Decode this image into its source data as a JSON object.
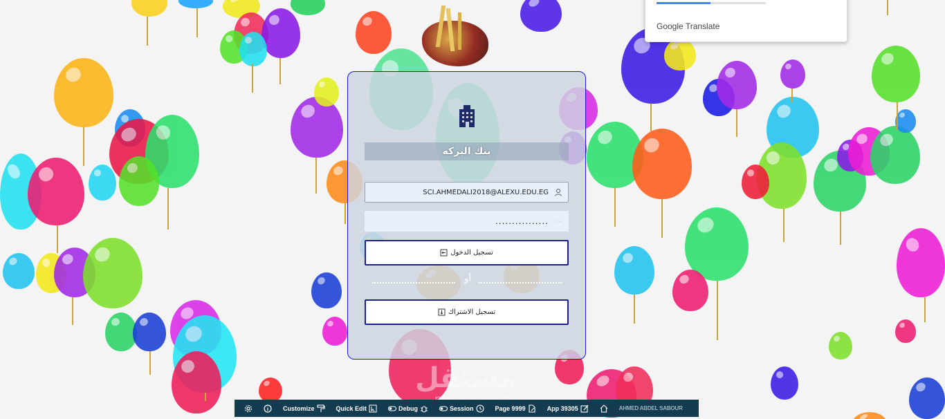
{
  "bank": {
    "title": "بنك البركه"
  },
  "login_form": {
    "email_value": "SCI.AHMEDALI2018@ALEXU.EDU.EG",
    "password_value": "................",
    "login_label": "تسجيل الدخول",
    "or_label": "أو",
    "register_label": "تسجيل الاشتراك"
  },
  "translate_popup": {
    "brand": "Google Translate"
  },
  "toolbar": {
    "customize": "Customize",
    "quick_edit": "Quick Edit",
    "debug": "Debug",
    "session": "Session",
    "page": "Page 9999",
    "app": "App 39305",
    "user": "AHMED ABDEL SABOUR"
  },
  "watermark": {
    "arabic": "مستقل",
    "latin": "mostaql.com"
  },
  "colors": {
    "card_border": "#1a1ad6",
    "button_border": "#1b1f8f",
    "toolbar_bg": "#143c50"
  }
}
